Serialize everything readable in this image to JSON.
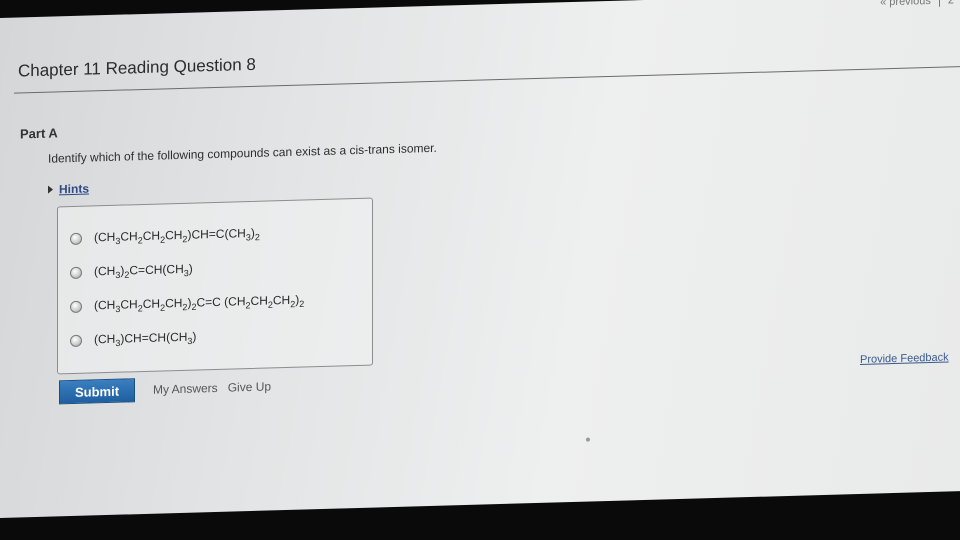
{
  "topbar": {
    "previous_label": "« previous",
    "page_fragment": "2"
  },
  "header": {
    "title": "Chapter 11 Reading Question 8"
  },
  "part": {
    "label": "Part A",
    "question": "Identify which of the following compounds can exist as a cis-trans isomer.",
    "hints_label": "Hints"
  },
  "options": [
    {
      "text": "(CH3CH2CH2CH2)CH=C(CH3)2"
    },
    {
      "text": "(CH3)2C=CH(CH3)"
    },
    {
      "text": "(CH3CH2CH2CH2)2C=C (CH2CH2CH2)2"
    },
    {
      "text": "(CH3)CH=CH(CH3)"
    }
  ],
  "actions": {
    "submit_label": "Submit",
    "my_answers_label": "My Answers",
    "give_up_label": "Give Up",
    "feedback_label": "Provide Feedback"
  },
  "colors": {
    "submit_bg": "#2a6eb0",
    "link": "#2f4a86"
  }
}
